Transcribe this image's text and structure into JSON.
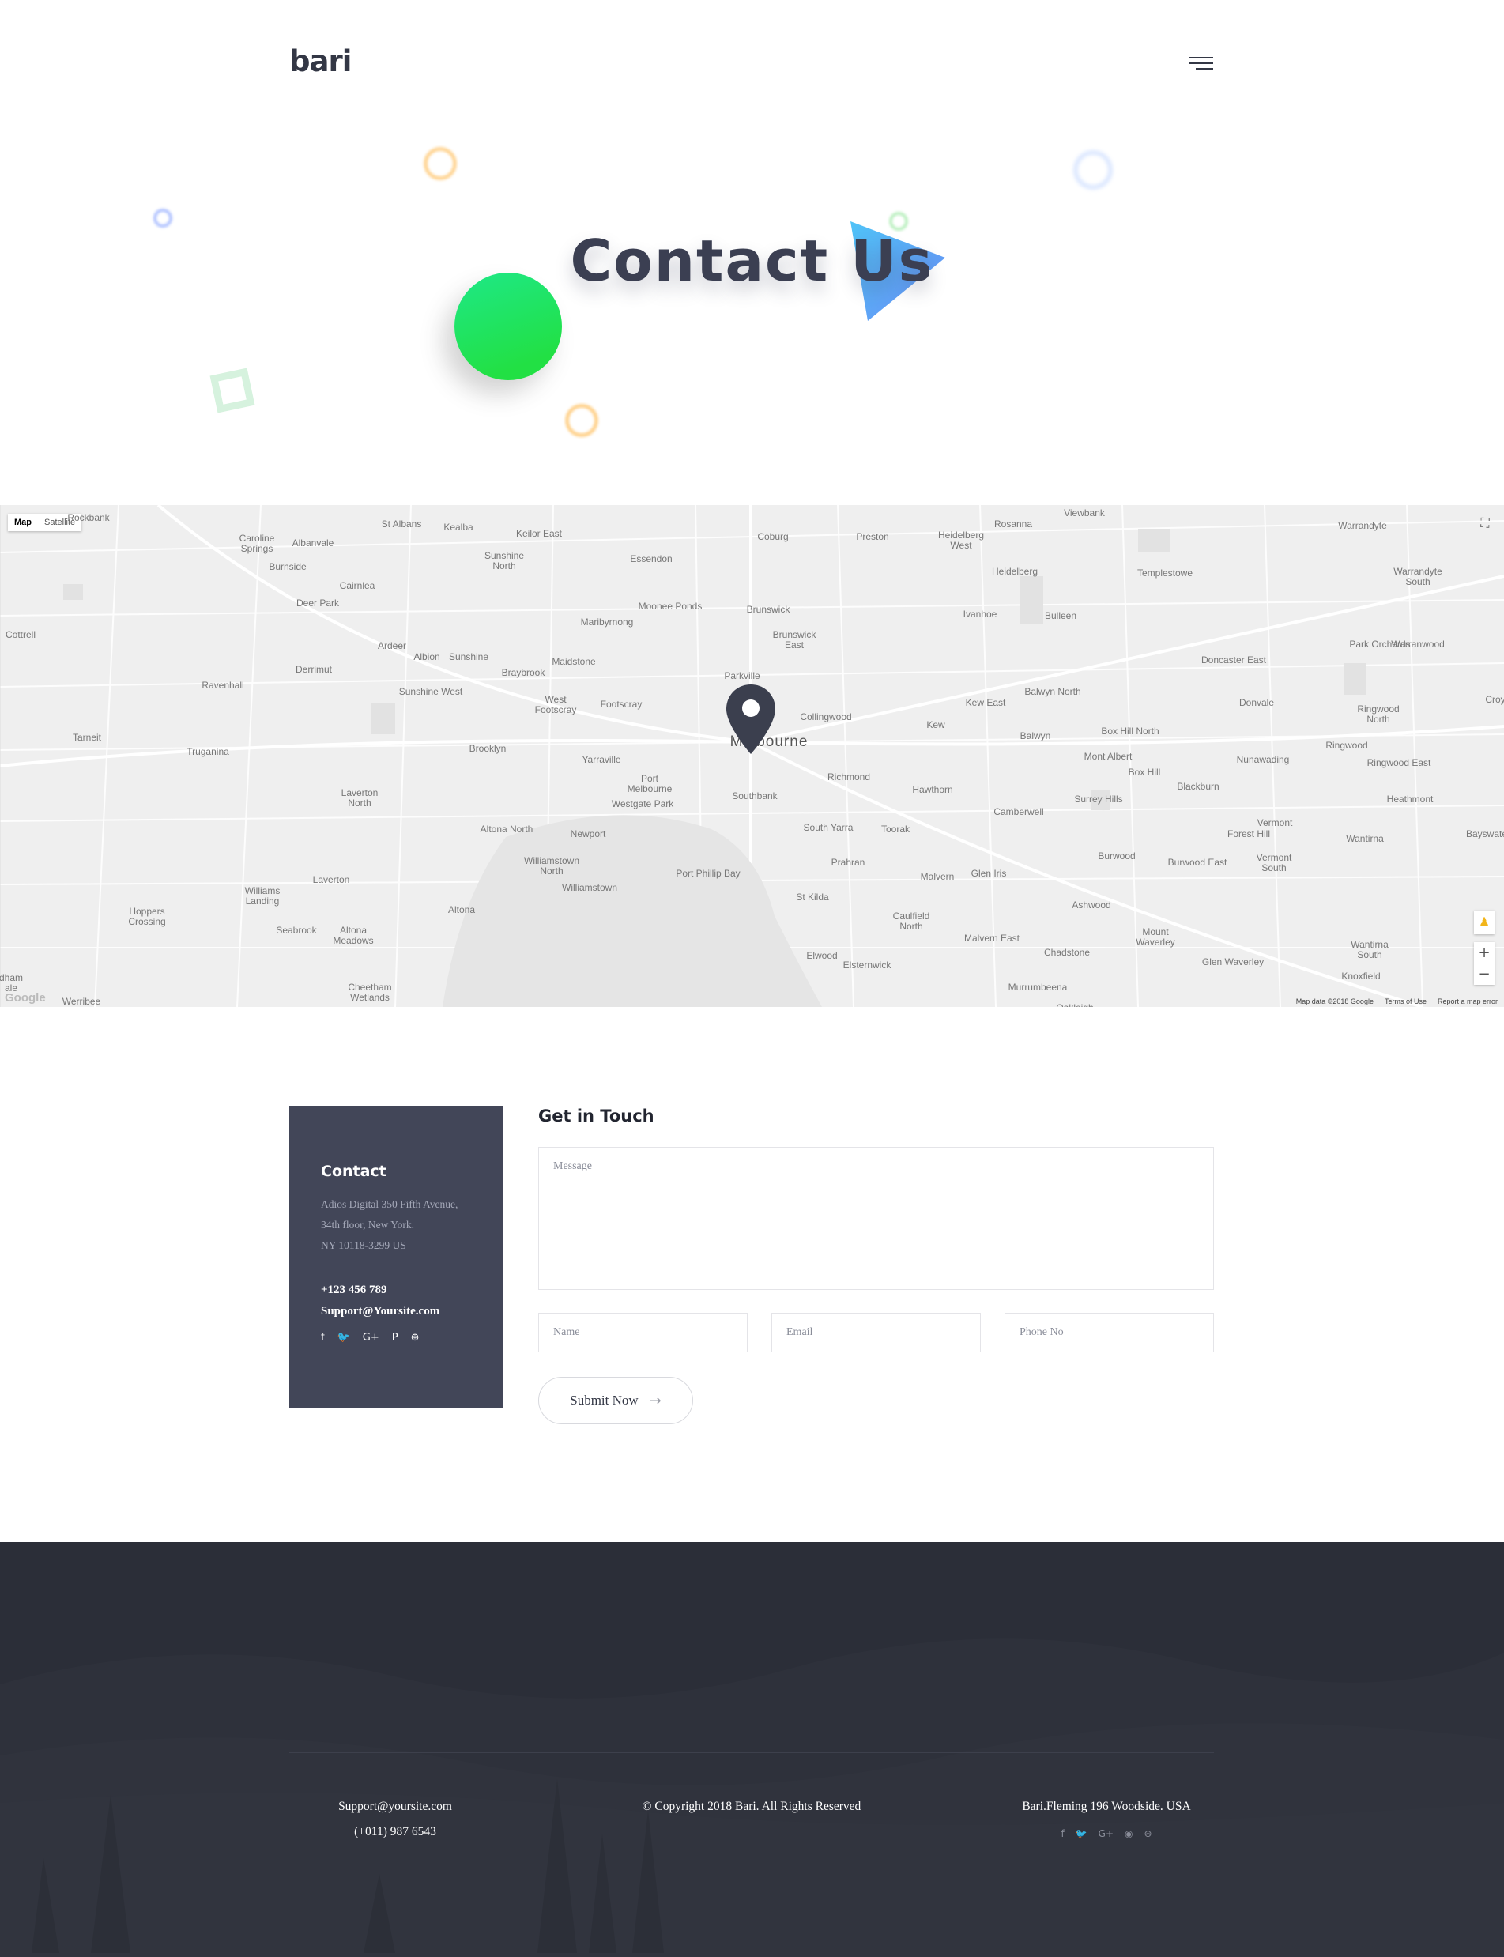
{
  "header": {
    "logo": "bari",
    "menu_icon": "hamburger-menu-icon"
  },
  "hero": {
    "title": "Contact Us"
  },
  "map": {
    "type_buttons": [
      "Map",
      "Satellite"
    ],
    "selected_type": "Map",
    "city_label": "Melbourne",
    "labels": [
      "Rockbank",
      "St Albans",
      "Keilor East",
      "Coburg",
      "Preston",
      "Rosanna",
      "Viewbank",
      "Warrandyte",
      "Caroline\nSprings",
      "Albanvale",
      "Kealba",
      "Heidelberg\nWest",
      "Essendon",
      "Burnside",
      "Sunshine\nNorth",
      "Heidelberg",
      "Templestowe",
      "Cairnlea",
      "Warrandyte\nSouth",
      "Deer Park",
      "Moonee Ponds",
      "Brunswick",
      "Ivanhoe",
      "Bulleen",
      "Cottrell",
      "Maribyrnong",
      "Ardeer",
      "Brunswick\nEast",
      "Albion",
      "Sunshine",
      "Maidstone",
      "Park Orchards",
      "Warranwood",
      "Derrimut",
      "Braybrook",
      "Doncaster East",
      "Ravenhall",
      "Sunshine West",
      "Parkville",
      "Balwyn North",
      "Footscray",
      "West\nFootscray",
      "Collingwood",
      "Kew East",
      "Donvale",
      "Croy",
      "Tarneit",
      "Ringwood\nNorth",
      "Kew",
      "Balwyn",
      "Box Hill North",
      "Truganina",
      "Brooklyn",
      "Yarraville",
      "Mont Albert",
      "Nunawading",
      "Ringwood",
      "Box Hill",
      "Ringwood East",
      "Port\nMelbourne",
      "Richmond",
      "Hawthorn",
      "Blackburn",
      "Laverton\nNorth",
      "Southbank",
      "Westgate Park",
      "Surrey Hills",
      "Heathmont",
      "Bayswater",
      "Altona North",
      "Newport",
      "Camberwell",
      "South Yarra",
      "Toorak",
      "Vermont",
      "Forest Hill",
      "Wantirna",
      "Williamstown\nNorth",
      "Prahran",
      "Burwood",
      "Burwood East",
      "Vermont\nSouth",
      "Laverton",
      "Port Phillip Bay",
      "Malvern",
      "Glen Iris",
      "Williams\nLanding",
      "Williamstown",
      "St Kilda",
      "Hoppers\nCrossing",
      "Altona",
      "Ashwood",
      "Caulfield\nNorth",
      "Seabrook",
      "Altona\nMeadows",
      "Mount\nWaverley",
      "Malvern East",
      "Wantirna\nSouth",
      "Chadstone",
      "Elwood",
      "Glen Waverley",
      "Elsternwick",
      "Knoxfield",
      "Cheetham\nWetlands",
      "Murrumbeena",
      "Werribee",
      "Oakleigh",
      "dham\nale"
    ],
    "attribution": [
      "Map data ©2018 Google",
      "Terms of Use",
      "Report a map error"
    ],
    "google_logo": "Google"
  },
  "contact": {
    "heading": "Contact",
    "address_lines": [
      "Adios Digital 350 Fifth Avenue,",
      "34th floor, New York.",
      "NY 10118-3299 US"
    ],
    "phone": "+123 456 789",
    "email": "Support@Yoursite.com",
    "socials": [
      "f",
      "🐦",
      "G+",
      "P",
      "⊛"
    ]
  },
  "form": {
    "title": "Get in Touch",
    "message_placeholder": "Message",
    "name_placeholder": "Name",
    "email_placeholder": "Email",
    "phone_placeholder": "Phone No",
    "submit_label": "Submit Now",
    "submit_arrow": "→"
  },
  "footer": {
    "email": "Support@yoursite.com",
    "phone": "(+011) 987 6543",
    "copyright": "© Copyright 2018 Bari. All Rights Reserved",
    "address": "Bari.Fleming 196 Woodside. USA",
    "socials": [
      "f",
      "🐦",
      "G+",
      "◉",
      "⊛"
    ]
  },
  "colors": {
    "dark": "#424658",
    "footer_bg": "#2b2e38",
    "accent_green": "#22e06a",
    "accent_blue": "#5ab4ee"
  }
}
